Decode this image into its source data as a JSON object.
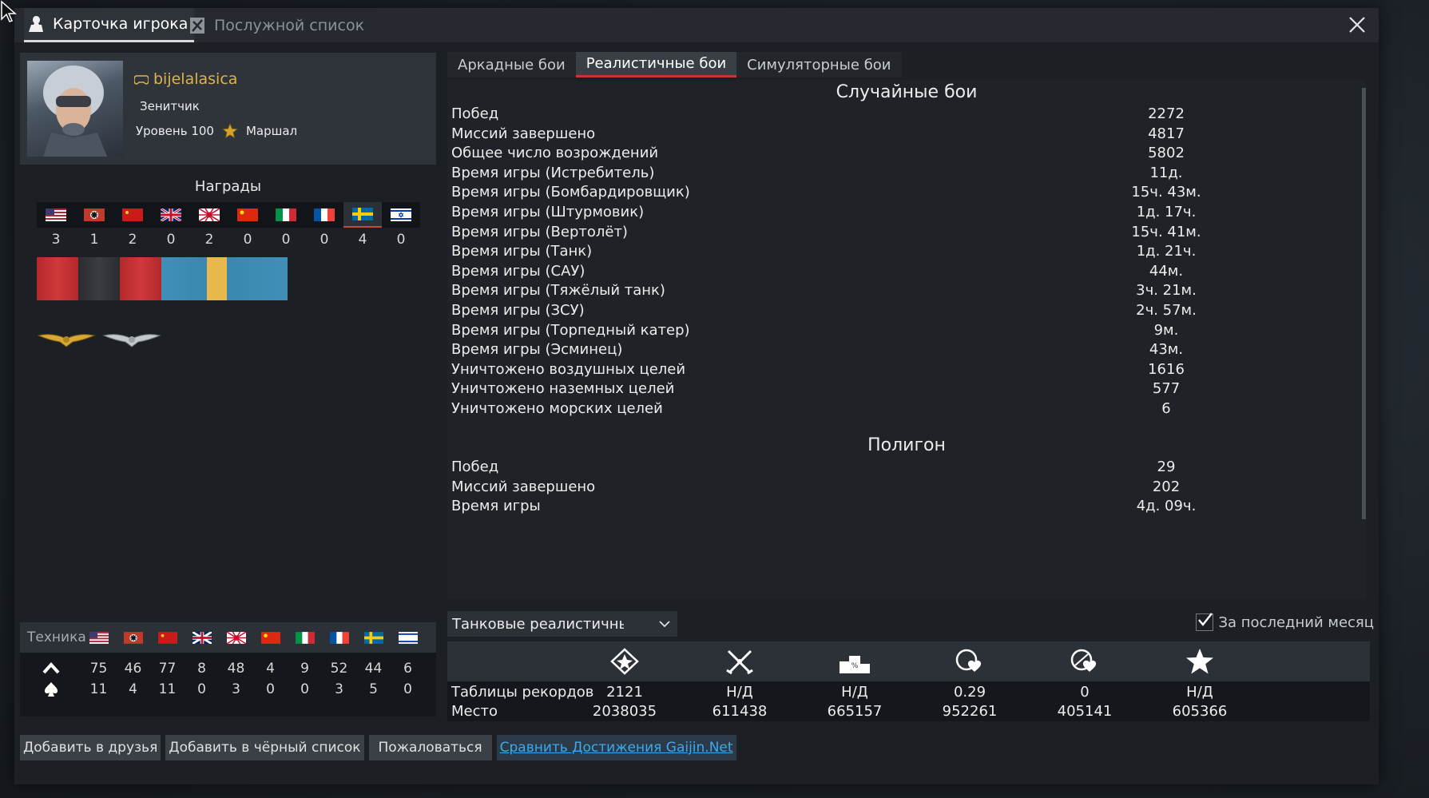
{
  "tabs": {
    "player_card": "Карточка игрока",
    "service_record": "Послужной список"
  },
  "profile": {
    "username": "bijelalasica",
    "title": "Зенитчик",
    "level": "Уровень 100",
    "rank": "Маршал"
  },
  "awards": {
    "title": "Награды",
    "counts": [
      "3",
      "1",
      "2",
      "0",
      "2",
      "0",
      "0",
      "0",
      "4",
      "0"
    ]
  },
  "vehicles": {
    "label": "Техника",
    "row1": [
      "75",
      "46",
      "77",
      "8",
      "48",
      "4",
      "9",
      "52",
      "44",
      "6"
    ],
    "row2": [
      "11",
      "4",
      "11",
      "0",
      "3",
      "0",
      "0",
      "3",
      "5",
      "0"
    ]
  },
  "buttons": {
    "add_friend": "Добавить в друзья",
    "add_blacklist": "Добавить в чёрный список",
    "report": "Пожаловаться",
    "compare": "Сравнить Достижения Gaijin.Net"
  },
  "mode_tabs": [
    "Аркадные бои",
    "Реалистичные бои",
    "Симуляторные бои"
  ],
  "random_battles": {
    "title": "Случайные бои",
    "rows": [
      {
        "label": "Побед",
        "value": "2272"
      },
      {
        "label": "Миссий завершено",
        "value": "4817"
      },
      {
        "label": "Общее число возрождений",
        "value": "5802"
      },
      {
        "label": "Время игры (Истребитель)",
        "value": "11д."
      },
      {
        "label": "Время игры (Бомбардировщик)",
        "value": "15ч. 43м."
      },
      {
        "label": "Время игры (Штурмовик)",
        "value": "1д. 17ч."
      },
      {
        "label": "Время игры (Вертолёт)",
        "value": "15ч. 41м."
      },
      {
        "label": "Время игры (Танк)",
        "value": "1д. 21ч."
      },
      {
        "label": "Время игры (САУ)",
        "value": "44м."
      },
      {
        "label": "Время игры (Тяжёлый танк)",
        "value": "3ч. 21м."
      },
      {
        "label": "Время игры (ЗСУ)",
        "value": "2ч. 57м."
      },
      {
        "label": "Время игры (Торпедный катер)",
        "value": "9м."
      },
      {
        "label": "Время игры (Эсминец)",
        "value": "43м."
      },
      {
        "label": "Уничтожено воздушных целей",
        "value": "1616"
      },
      {
        "label": "Уничтожено наземных целей",
        "value": "577"
      },
      {
        "label": "Уничтожено морских целей",
        "value": "6"
      }
    ]
  },
  "polygon": {
    "title": "Полигон",
    "rows": [
      {
        "label": "Побед",
        "value": "29"
      },
      {
        "label": "Миссий завершено",
        "value": "202"
      },
      {
        "label": "Время игры",
        "value": "4д. 09ч."
      }
    ]
  },
  "mode_select": "Танковые реалистичные бои",
  "last_month": "За последний месяц",
  "records": {
    "row_labels": [
      "Таблицы рекордов",
      "Место"
    ],
    "values": [
      "2121",
      "Н/Д",
      "Н/Д",
      "0.29",
      "0",
      "Н/Д"
    ],
    "places": [
      "2038035",
      "611438",
      "665157",
      "952261",
      "405141",
      "605366"
    ]
  }
}
